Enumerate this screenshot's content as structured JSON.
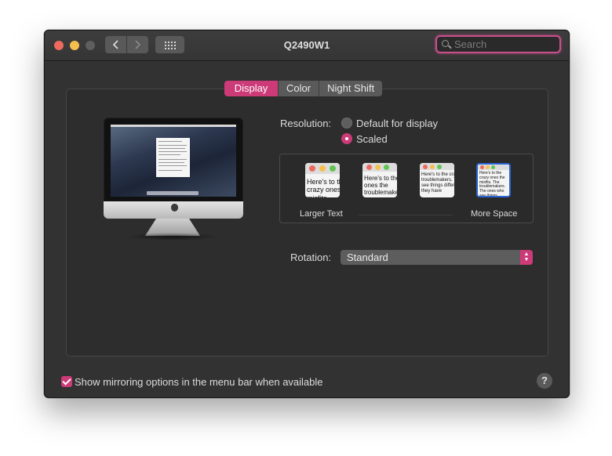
{
  "window": {
    "title": "Q2490W1"
  },
  "toolbar": {
    "back_icon": "chevron-left-icon",
    "forward_icon": "chevron-right-icon",
    "grid_icon": "show-all-grid-icon",
    "search_placeholder": "Search"
  },
  "tabs": [
    {
      "label": "Display",
      "active": true
    },
    {
      "label": "Color",
      "active": false
    },
    {
      "label": "Night Shift",
      "active": false
    }
  ],
  "resolution": {
    "label": "Resolution:",
    "options": [
      {
        "label": "Default for display",
        "selected": false
      },
      {
        "label": "Scaled",
        "selected": true
      }
    ]
  },
  "scaling": {
    "thumbnails": [
      {
        "text": "Here's to the crazy ones the misfits",
        "selected": false
      },
      {
        "text": "Here's to the crazy ones the troublemakers",
        "selected": false
      },
      {
        "text": "Here's to the crazy ones the troublemakers. The ones who see things differently. rules. And they have",
        "selected": false
      },
      {
        "text": "Here's to the crazy ones the misfits. The troublemakers. The ones who see things differently. They're not fond of rules. And they have no respect for the status quo. You can quote them, disagree with them. About the only thing you can't do is ignore them. Because they change things",
        "selected": true
      }
    ],
    "left_label": "Larger Text",
    "right_label": "More Space"
  },
  "rotation": {
    "label": "Rotation:",
    "value": "Standard"
  },
  "mirroring": {
    "label": "Show mirroring options in the menu bar when available",
    "checked": true
  },
  "help": {
    "label": "?"
  },
  "colors": {
    "accent": "#cc3b78",
    "window_bg": "#323232",
    "panel_bg": "#2d2d2d"
  }
}
